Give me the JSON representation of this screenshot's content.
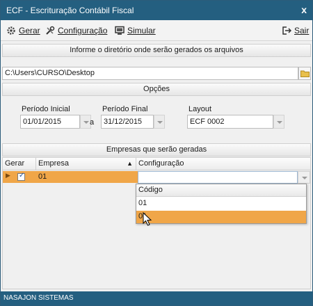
{
  "window": {
    "title": "ECF - Escrituração Contábil Fiscal",
    "close_glyph": "x"
  },
  "toolbar": {
    "gerar": "Gerar",
    "configuracao": "Configuração",
    "simular": "Simular",
    "sair": "Sair"
  },
  "directory": {
    "header": "Informe o diretório onde serão gerados os arquivos",
    "path": "C:\\Users\\CURSO\\Desktop"
  },
  "options": {
    "header": "Opções",
    "periodo_inicial_label": "Período Inicial",
    "periodo_inicial_value": "01/01/2015",
    "separator": "a",
    "periodo_final_label": "Período Final",
    "periodo_final_value": "31/12/2015",
    "layout_label": "Layout",
    "layout_value": "ECF 0002"
  },
  "companies": {
    "header": "Empresas que serão geradas",
    "columns": [
      "Gerar",
      "Empresa",
      "Configuração"
    ],
    "rows": [
      {
        "gerar": true,
        "empresa": "01",
        "configuracao": ""
      }
    ]
  },
  "popup": {
    "header": "Código",
    "items": [
      "01",
      "01"
    ],
    "selected_index": 1
  },
  "status": {
    "text": "NASAJON SISTEMAS"
  },
  "colors": {
    "title_bar": "#245f80",
    "selection": "#f0a648"
  }
}
